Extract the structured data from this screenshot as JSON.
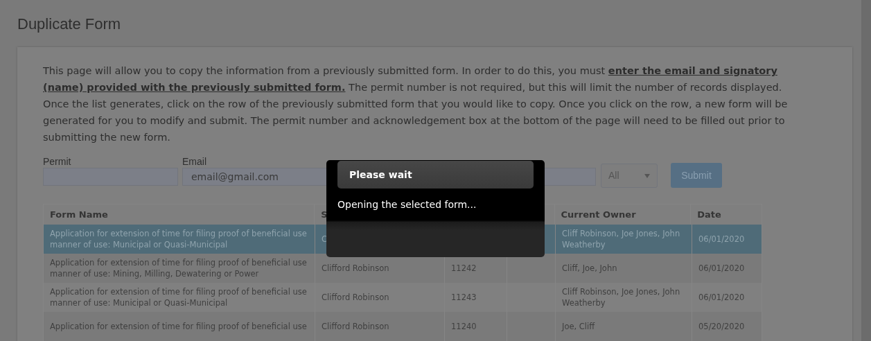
{
  "page_title": "Duplicate Form",
  "intro": {
    "before": "This page will allow you to copy the information from a previously submitted form. In order to do this, you must ",
    "emphasis": "enter the email and signatory (name) provided with the previously submitted form.",
    "after": " The permit number is not required, but this will limit the number of records displayed. Once the list generates, click on the row of the previously submitted form that you would like to copy. Once you click on the row, a new form will be generated for you to modify and submit. The permit number and acknowledgement box at the bottom of the page will need to be filled out prior to submitting the new form."
  },
  "filters": {
    "permit": {
      "label": "Permit"
    },
    "email": {
      "label": "Email",
      "value": "email@gmail.com"
    },
    "select": {
      "value": "All"
    },
    "submit": "Submit"
  },
  "table": {
    "columns": [
      "Form Name",
      "S",
      "",
      "",
      "Current Owner",
      "Date"
    ],
    "rows": [
      {
        "selected": true,
        "cells": [
          "Application for extension of time for filing proof of beneficial use manner of use: Municipal or Quasi-Municipal",
          "C",
          "",
          "",
          "Cliff Robinson, Joe Jones, John Weatherby",
          "06/01/2020"
        ]
      },
      {
        "selected": false,
        "cells": [
          "Application for extension of time for filing proof of beneficial use manner of use: Mining, Milling, Dewatering or Power",
          "Clifford Robinson",
          "11242",
          "",
          "Cliff, Joe, John",
          "06/01/2020"
        ]
      },
      {
        "selected": false,
        "cells": [
          "Application for extension of time for filing proof of beneficial use manner of use: Municipal or Quasi-Municipal",
          "Clifford Robinson",
          "11243",
          "",
          "Cliff Robinson, Joe Jones, John Weatherby",
          "06/01/2020"
        ]
      },
      {
        "selected": false,
        "cells": [
          "Application for extension of time for filing proof of beneficial use",
          "Clifford Robinson",
          "11240",
          "",
          "Joe, Cliff",
          "05/20/2020"
        ]
      }
    ]
  },
  "dialog": {
    "title": "Please wait",
    "message": "Opening the selected form..."
  }
}
